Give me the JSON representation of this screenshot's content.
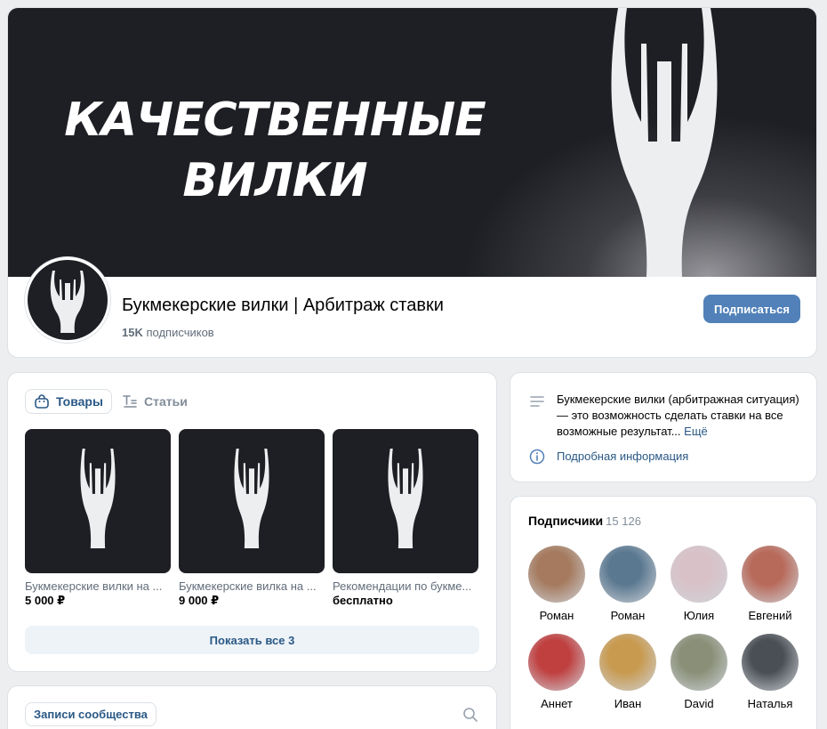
{
  "cover": {
    "headline_line1": "КАЧЕСТВЕННЫЕ",
    "headline_line2": "ВИЛКИ"
  },
  "group": {
    "name": "Букмекерские вилки | Арбитраж ставки",
    "subscribers_short": "15K",
    "subscribers_word": "подписчиков",
    "subscribe_label": "Подписаться"
  },
  "goods": {
    "tabs": [
      {
        "label": "Товары",
        "icon": "bag-icon",
        "active": true
      },
      {
        "label": "Статьи",
        "icon": "articles-icon",
        "active": false
      }
    ],
    "products": [
      {
        "name": "Букмекерские вилки на ...",
        "price": "5 000 ₽"
      },
      {
        "name": "Букмекерские вилка на ...",
        "price": "9 000 ₽"
      },
      {
        "name": "Рекомендации по букме...",
        "price": "бесплатно"
      }
    ],
    "show_all_label": "Показать все 3"
  },
  "posts": {
    "tab_label": "Записи сообщества",
    "search_icon": "search-icon"
  },
  "about": {
    "text": "Букмекерские вилки (арбитражная ситуация)— это возможность сделать ставки на все возможные результат...",
    "more_label": "Ещё",
    "info_label": "Подробная информация"
  },
  "followers": {
    "title": "Подписчики",
    "count": "15 126",
    "people": [
      {
        "name": "Роман",
        "color": "#a57a5e"
      },
      {
        "name": "Роман",
        "color": "#5a7890"
      },
      {
        "name": "Юлия",
        "color": "#d8c2c8"
      },
      {
        "name": "Евгений",
        "color": "#b86a5a"
      },
      {
        "name": "Аннет",
        "color": "#c04040"
      },
      {
        "name": "Иван",
        "color": "#c89a50"
      },
      {
        "name": "David",
        "color": "#8a9078"
      },
      {
        "name": "Наталья",
        "color": "#4a4f55"
      }
    ]
  },
  "colors": {
    "accent": "#5181b8",
    "link": "#2a5885",
    "background": "#edeef0",
    "cover": "#1e1f24"
  }
}
